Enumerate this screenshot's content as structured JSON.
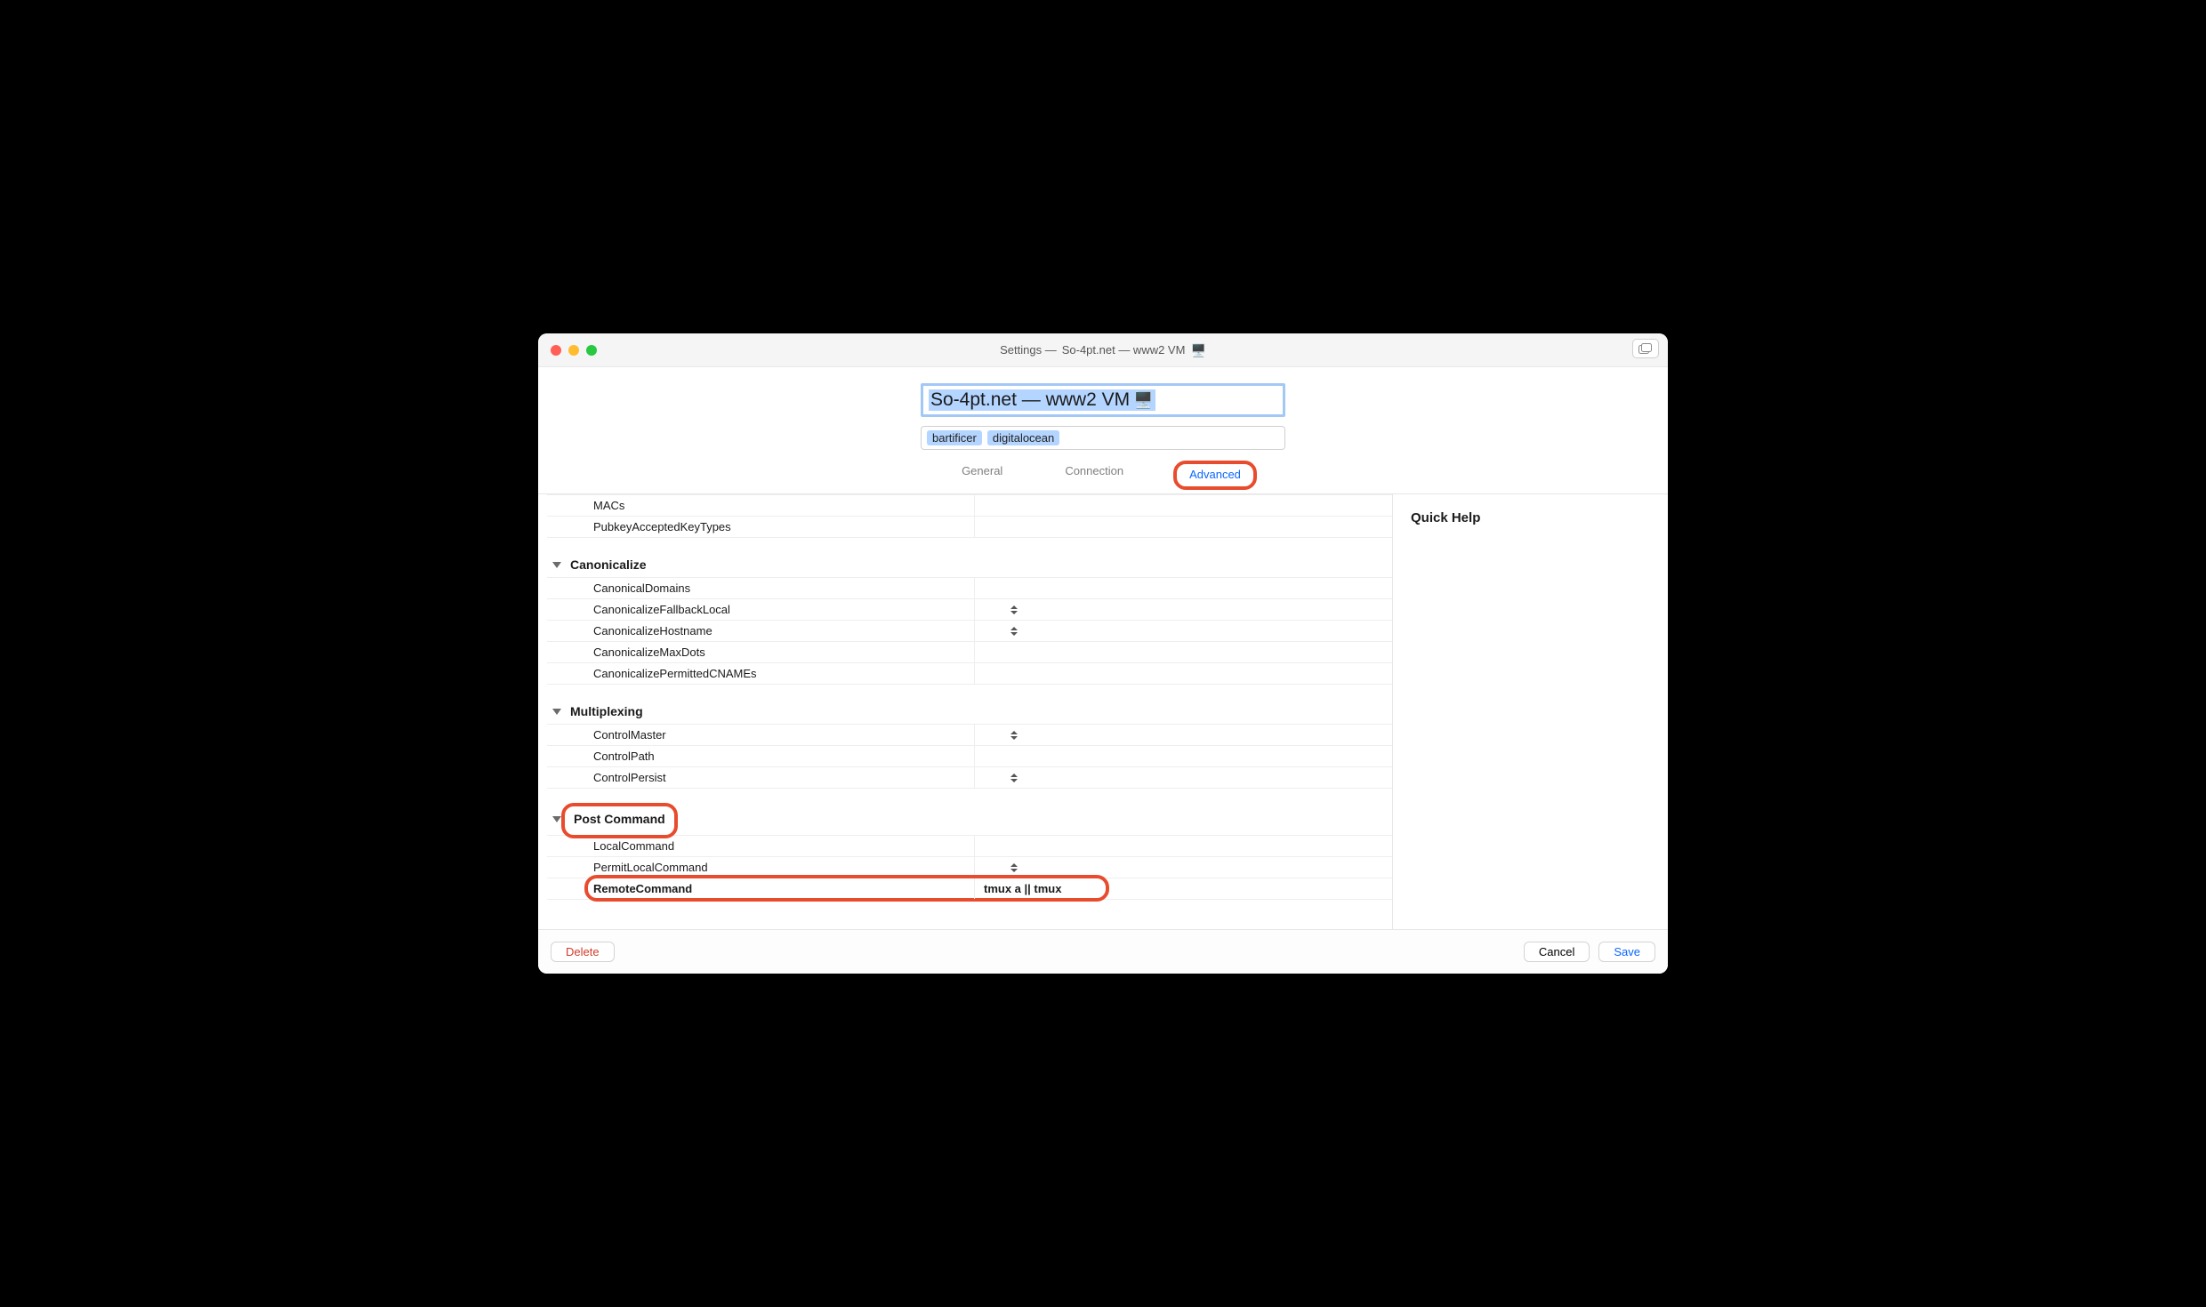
{
  "window": {
    "title_prefix": "Settings — ",
    "title_name": "So-4pt.net — www2 VM"
  },
  "header": {
    "name_value": "So-4pt.net — www2 VM",
    "tags": [
      "bartificer",
      "digitalocean"
    ]
  },
  "tabs": {
    "general": "General",
    "connection": "Connection",
    "advanced": "Advanced"
  },
  "sections": {
    "top_rows": [
      {
        "key": "MACs"
      },
      {
        "key": "PubkeyAcceptedKeyTypes"
      }
    ],
    "canonicalize": {
      "title": "Canonicalize",
      "rows": [
        {
          "key": "CanonicalDomains"
        },
        {
          "key": "CanonicalizeFallbackLocal",
          "stepper": true
        },
        {
          "key": "CanonicalizeHostname",
          "stepper": true
        },
        {
          "key": "CanonicalizeMaxDots"
        },
        {
          "key": "CanonicalizePermittedCNAMEs"
        }
      ]
    },
    "multiplexing": {
      "title": "Multiplexing",
      "rows": [
        {
          "key": "ControlMaster",
          "stepper": true
        },
        {
          "key": "ControlPath"
        },
        {
          "key": "ControlPersist",
          "stepper": true
        }
      ]
    },
    "post_command": {
      "title": "Post Command",
      "rows": [
        {
          "key": "LocalCommand"
        },
        {
          "key": "PermitLocalCommand",
          "stepper": true
        },
        {
          "key": "RemoteCommand",
          "value": "tmux a || tmux",
          "bold": true
        }
      ]
    }
  },
  "sidebar": {
    "quick_help_title": "Quick Help"
  },
  "footer": {
    "delete": "Delete",
    "cancel": "Cancel",
    "save": "Save"
  }
}
